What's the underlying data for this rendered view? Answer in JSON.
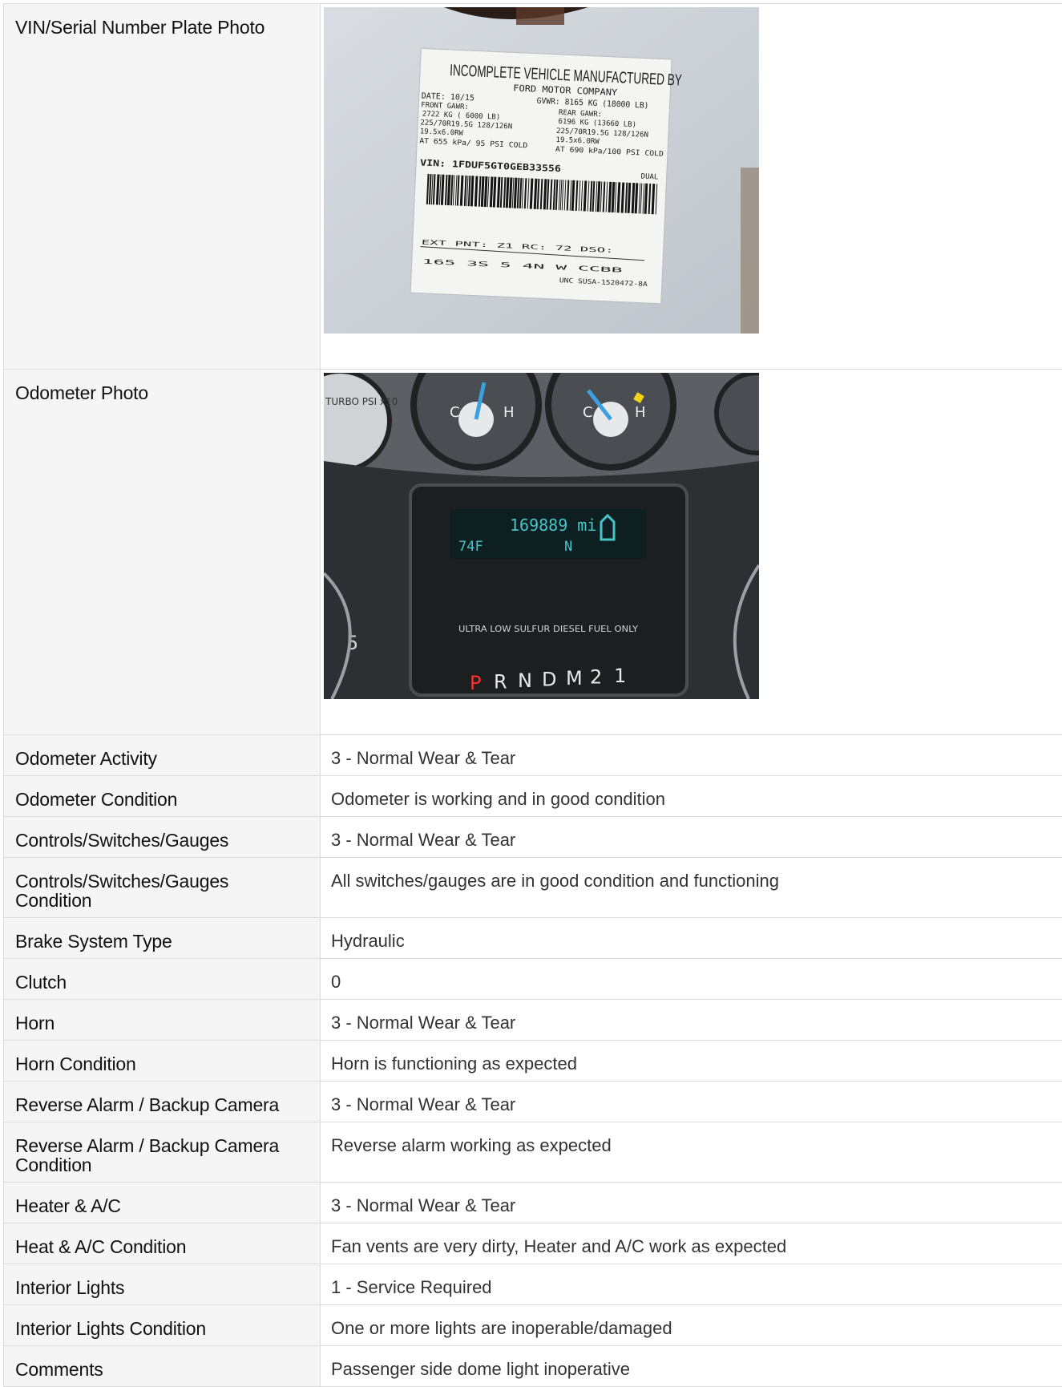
{
  "rows": [
    {
      "label": "VIN/Serial Number Plate Photo",
      "type": "photo",
      "photo": "vin-plate"
    },
    {
      "label": "Odometer Photo",
      "type": "photo",
      "photo": "odometer"
    },
    {
      "label": "Odometer Activity",
      "value": "3 - Normal Wear & Tear"
    },
    {
      "label": "Odometer Condition",
      "value": "Odometer is working and in good condition"
    },
    {
      "label": "Controls/Switches/Gauges",
      "value": "3 - Normal Wear & Tear"
    },
    {
      "label": "Controls/Switches/Gauges Condition",
      "value": "All switches/gauges are in good condition and functioning"
    },
    {
      "label": "Brake System Type",
      "value": "Hydraulic"
    },
    {
      "label": "Clutch",
      "value": "0"
    },
    {
      "label": "Horn",
      "value": "3 - Normal Wear & Tear"
    },
    {
      "label": "Horn Condition",
      "value": "Horn is functioning as expected"
    },
    {
      "label": "Reverse Alarm / Backup Camera",
      "value": "3 - Normal Wear & Tear"
    },
    {
      "label": "Reverse Alarm / Backup Camera Condition",
      "value": "Reverse alarm working as expected"
    },
    {
      "label": "Heater & A/C",
      "value": "3 - Normal Wear & Tear"
    },
    {
      "label": "Heat & A/C Condition",
      "value": "Fan vents are very dirty, Heater and A/C work as expected"
    },
    {
      "label": "Interior Lights",
      "value": "1 - Service Required"
    },
    {
      "label": "Interior Lights Condition",
      "value": "One or more lights are inoperable/damaged"
    },
    {
      "label": "Comments",
      "value": "Passenger side dome light inoperative"
    }
  ],
  "vin_label": {
    "title": "INCOMPLETE VEHICLE MANUFACTURED BY",
    "maker": "FORD MOTOR COMPANY",
    "date": "DATE: 10/15",
    "gvwr": "GVWR: 8165 KG (18000 LB)",
    "front_gawr": "FRONT GAWR:",
    "front_kg": "2722 KG ( 6000 LB)",
    "rear_gawr": "REAR GAWR:",
    "rear_kg": "6196 KG (13660 LB)",
    "tire": "225/70R19.5G 128/126N",
    "rim": "19.5x6.0RW",
    "psi_front": "AT 655 kPa/ 95 PSI COLD",
    "psi_rear": "AT 690 kPa/100 PSI COLD",
    "vin": "VIN: 1FDUF5GT0GEB33556",
    "dual": "DUAL",
    "codes1": "EXT PNT: Z1 RC: 72 DSO:",
    "codes2": "165 3S 5 4N W CCBB",
    "codes3": "UNC SUSA-1520472-8A"
  },
  "odometer_display": {
    "mileage": "169889 mi",
    "temp": "74F",
    "gear_indicator": "N",
    "fuel_note": "ULTRA LOW SULFUR DIESEL FUEL ONLY",
    "gears": [
      "P",
      "R",
      "N",
      "D",
      "M",
      "2",
      "1"
    ],
    "gauge_left": "TURBO PSI x10",
    "gauge_c": "C",
    "gauge_h": "H",
    "speedo_digit": "5"
  }
}
